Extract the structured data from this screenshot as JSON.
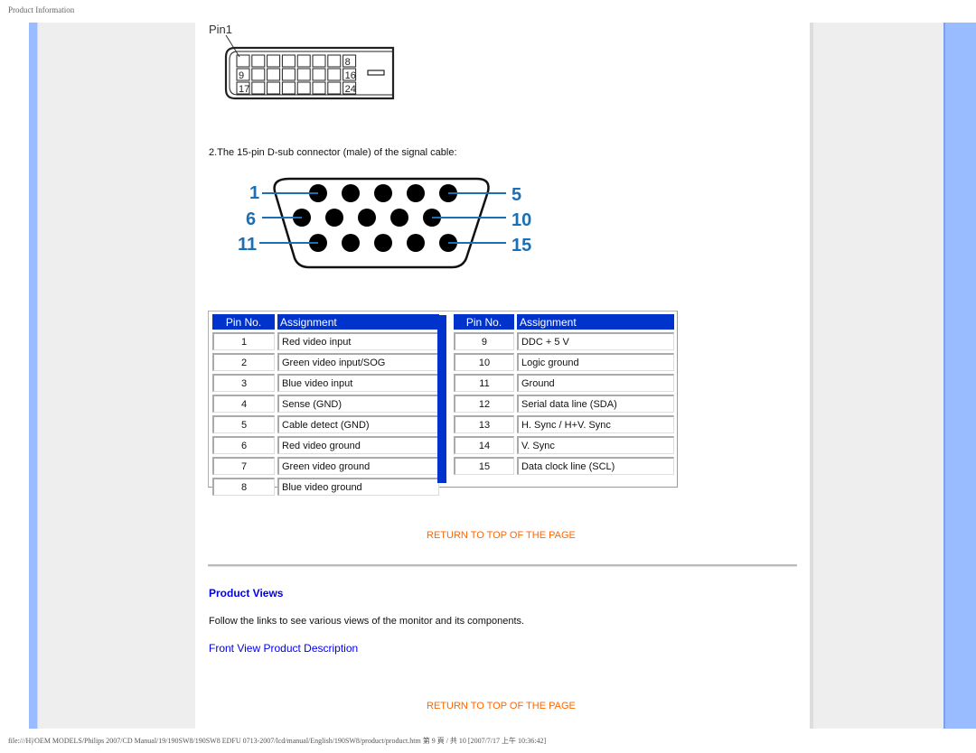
{
  "header": {
    "title": "Product Information"
  },
  "dvi_connector": {
    "pin1_label": "Pin1",
    "row_labels": [
      "8",
      "9",
      "16",
      "17",
      "24"
    ]
  },
  "vga_section": {
    "intro": "2.The 15-pin D-sub connector (male) of the signal cable:",
    "labels": {
      "row1_left": "1",
      "row1_right": "5",
      "row2_left": "6",
      "row2_right": "10",
      "row3_left": "11",
      "row3_right": "15"
    },
    "label_color": "#1a6fb5"
  },
  "pin_table": {
    "headers": {
      "pin": "Pin No.",
      "assignment": "Assignment"
    },
    "left": [
      {
        "pin": "1",
        "assignment": "Red video input"
      },
      {
        "pin": "2",
        "assignment": "Green video input/SOG"
      },
      {
        "pin": "3",
        "assignment": "Blue video input"
      },
      {
        "pin": "4",
        "assignment": "Sense (GND)"
      },
      {
        "pin": "5",
        "assignment": "Cable detect (GND)"
      },
      {
        "pin": "6",
        "assignment": "Red video ground"
      },
      {
        "pin": "7",
        "assignment": "Green video ground"
      },
      {
        "pin": "8",
        "assignment": "Blue video ground"
      }
    ],
    "right": [
      {
        "pin": "9",
        "assignment": "DDC + 5 V"
      },
      {
        "pin": "10",
        "assignment": "Logic ground"
      },
      {
        "pin": "11",
        "assignment": "Ground"
      },
      {
        "pin": "12",
        "assignment": "Serial data line (SDA)"
      },
      {
        "pin": "13",
        "assignment": "H. Sync / H+V. Sync"
      },
      {
        "pin": "14",
        "assignment": "V. Sync"
      },
      {
        "pin": "15",
        "assignment": "Data clock line (SCL)"
      }
    ],
    "header_color": "#0033cc"
  },
  "links": {
    "return_top_1": "RETURN TO TOP OF THE PAGE",
    "return_top_2": "RETURN TO TOP OF THE PAGE",
    "return_color": "#ff6600"
  },
  "product_views": {
    "title": "Product Views",
    "text": "Follow the links to see various views of the monitor and its components.",
    "front_view_link": "Front View Product Description"
  },
  "footer": {
    "path": "file:///H|/OEM MODELS/Philips 2007/CD Manual/19/190SW8/190SW8 EDFU 0713-2007/lcd/manual/English/190SW8/product/product.htm 第 9 頁 / 共 10 [2007/7/17 上午 10:36:42]"
  }
}
